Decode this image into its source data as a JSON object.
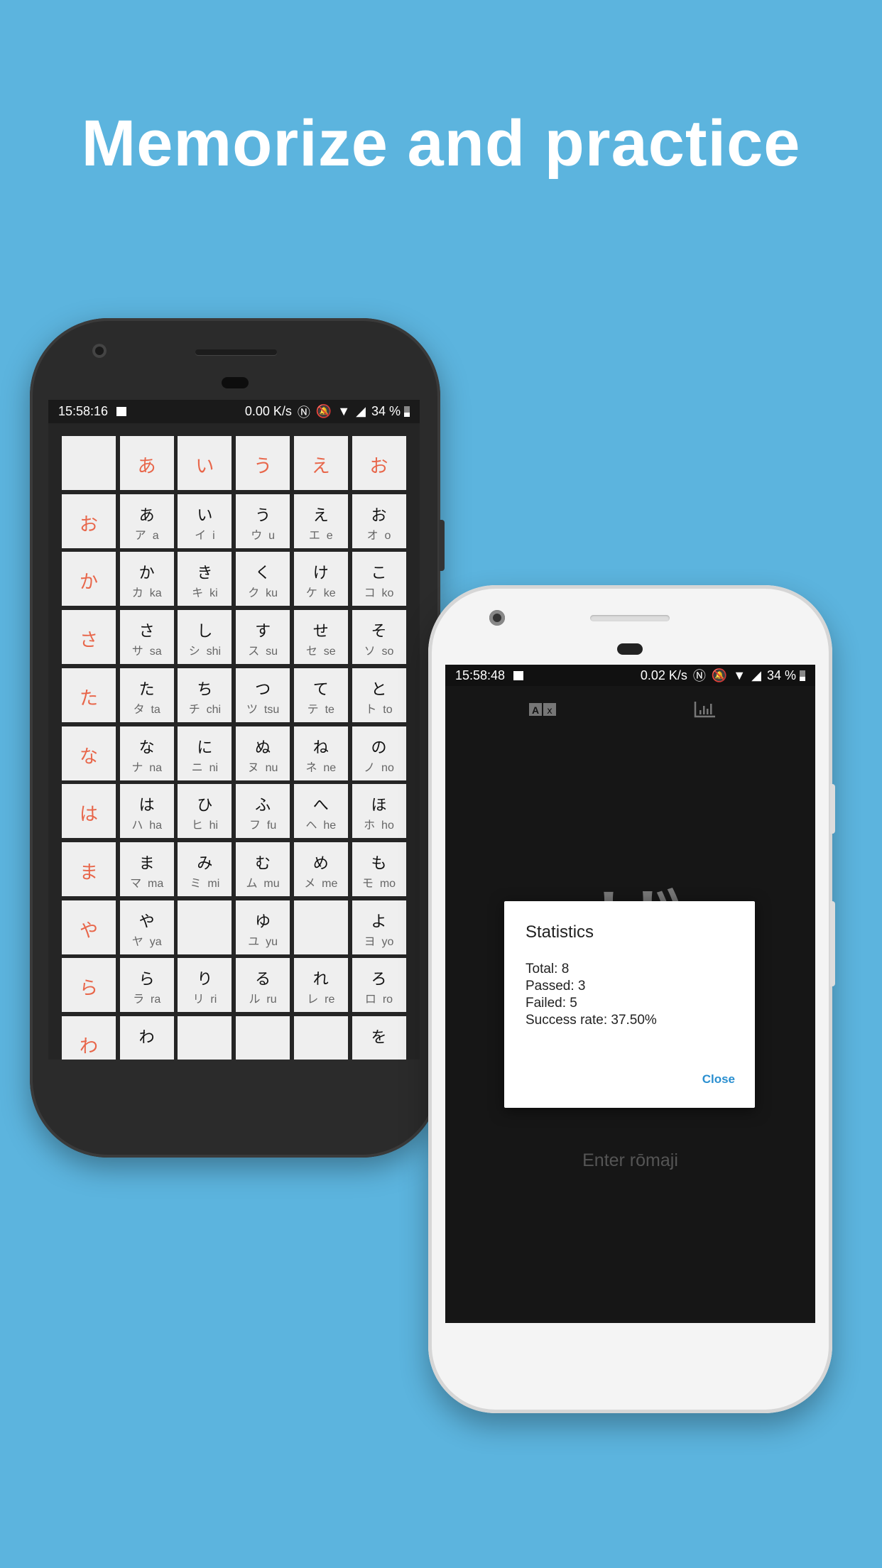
{
  "headline": "Memorize and practice",
  "colors": {
    "background": "#5cb4de",
    "accent_kana": "#e8664a",
    "dialog_button": "#2a8fd0"
  },
  "left_phone": {
    "status_bar": {
      "time": "15:58:16",
      "speed": "0.00 K/s",
      "battery": "34 %"
    },
    "grid": {
      "column_headers": [
        "",
        "あ",
        "い",
        "う",
        "え",
        "お"
      ],
      "rows": [
        {
          "header": "お",
          "cells": [
            {
              "h": "あ",
              "k": "ア",
              "r": "a"
            },
            {
              "h": "い",
              "k": "イ",
              "r": "i"
            },
            {
              "h": "う",
              "k": "ウ",
              "r": "u"
            },
            {
              "h": "え",
              "k": "エ",
              "r": "e"
            },
            {
              "h": "お",
              "k": "オ",
              "r": "o"
            }
          ]
        },
        {
          "header": "か",
          "cells": [
            {
              "h": "か",
              "k": "カ",
              "r": "ka"
            },
            {
              "h": "き",
              "k": "キ",
              "r": "ki"
            },
            {
              "h": "く",
              "k": "ク",
              "r": "ku"
            },
            {
              "h": "け",
              "k": "ケ",
              "r": "ke"
            },
            {
              "h": "こ",
              "k": "コ",
              "r": "ko"
            }
          ]
        },
        {
          "header": "さ",
          "cells": [
            {
              "h": "さ",
              "k": "サ",
              "r": "sa"
            },
            {
              "h": "し",
              "k": "シ",
              "r": "shi"
            },
            {
              "h": "す",
              "k": "ス",
              "r": "su"
            },
            {
              "h": "せ",
              "k": "セ",
              "r": "se"
            },
            {
              "h": "そ",
              "k": "ソ",
              "r": "so"
            }
          ]
        },
        {
          "header": "た",
          "cells": [
            {
              "h": "た",
              "k": "タ",
              "r": "ta"
            },
            {
              "h": "ち",
              "k": "チ",
              "r": "chi"
            },
            {
              "h": "つ",
              "k": "ツ",
              "r": "tsu"
            },
            {
              "h": "て",
              "k": "テ",
              "r": "te"
            },
            {
              "h": "と",
              "k": "ト",
              "r": "to"
            }
          ]
        },
        {
          "header": "な",
          "cells": [
            {
              "h": "な",
              "k": "ナ",
              "r": "na"
            },
            {
              "h": "に",
              "k": "ニ",
              "r": "ni"
            },
            {
              "h": "ぬ",
              "k": "ヌ",
              "r": "nu"
            },
            {
              "h": "ね",
              "k": "ネ",
              "r": "ne"
            },
            {
              "h": "の",
              "k": "ノ",
              "r": "no"
            }
          ]
        },
        {
          "header": "は",
          "cells": [
            {
              "h": "は",
              "k": "ハ",
              "r": "ha"
            },
            {
              "h": "ひ",
              "k": "ヒ",
              "r": "hi"
            },
            {
              "h": "ふ",
              "k": "フ",
              "r": "fu"
            },
            {
              "h": "へ",
              "k": "ヘ",
              "r": "he"
            },
            {
              "h": "ほ",
              "k": "ホ",
              "r": "ho"
            }
          ]
        },
        {
          "header": "ま",
          "cells": [
            {
              "h": "ま",
              "k": "マ",
              "r": "ma"
            },
            {
              "h": "み",
              "k": "ミ",
              "r": "mi"
            },
            {
              "h": "む",
              "k": "ム",
              "r": "mu"
            },
            {
              "h": "め",
              "k": "メ",
              "r": "me"
            },
            {
              "h": "も",
              "k": "モ",
              "r": "mo"
            }
          ]
        },
        {
          "header": "や",
          "cells": [
            {
              "h": "や",
              "k": "ヤ",
              "r": "ya"
            },
            null,
            {
              "h": "ゆ",
              "k": "ユ",
              "r": "yu"
            },
            null,
            {
              "h": "よ",
              "k": "ヨ",
              "r": "yo"
            }
          ]
        },
        {
          "header": "ら",
          "cells": [
            {
              "h": "ら",
              "k": "ラ",
              "r": "ra"
            },
            {
              "h": "り",
              "k": "リ",
              "r": "ri"
            },
            {
              "h": "る",
              "k": "ル",
              "r": "ru"
            },
            {
              "h": "れ",
              "k": "レ",
              "r": "re"
            },
            {
              "h": "ろ",
              "k": "ロ",
              "r": "ro"
            }
          ]
        },
        {
          "header": "わ",
          "cells": [
            {
              "h": "わ"
            },
            null,
            null,
            null,
            {
              "h": "を"
            }
          ]
        }
      ]
    }
  },
  "right_phone": {
    "status_bar": {
      "time": "15:58:48",
      "speed": "0.02 K/s",
      "battery": "34 %"
    },
    "toolbar": {
      "left_icon": "translate-icon",
      "right_icon": "bar-chart-icon"
    },
    "current_character": "ザ",
    "dialog": {
      "title": "Statistics",
      "total": "Total: 8",
      "passed": "Passed: 3",
      "failed": "Failed: 5",
      "success_rate": "Success rate: 37.50%",
      "close_label": "Close"
    },
    "input_placeholder": "Enter rōmaji"
  }
}
